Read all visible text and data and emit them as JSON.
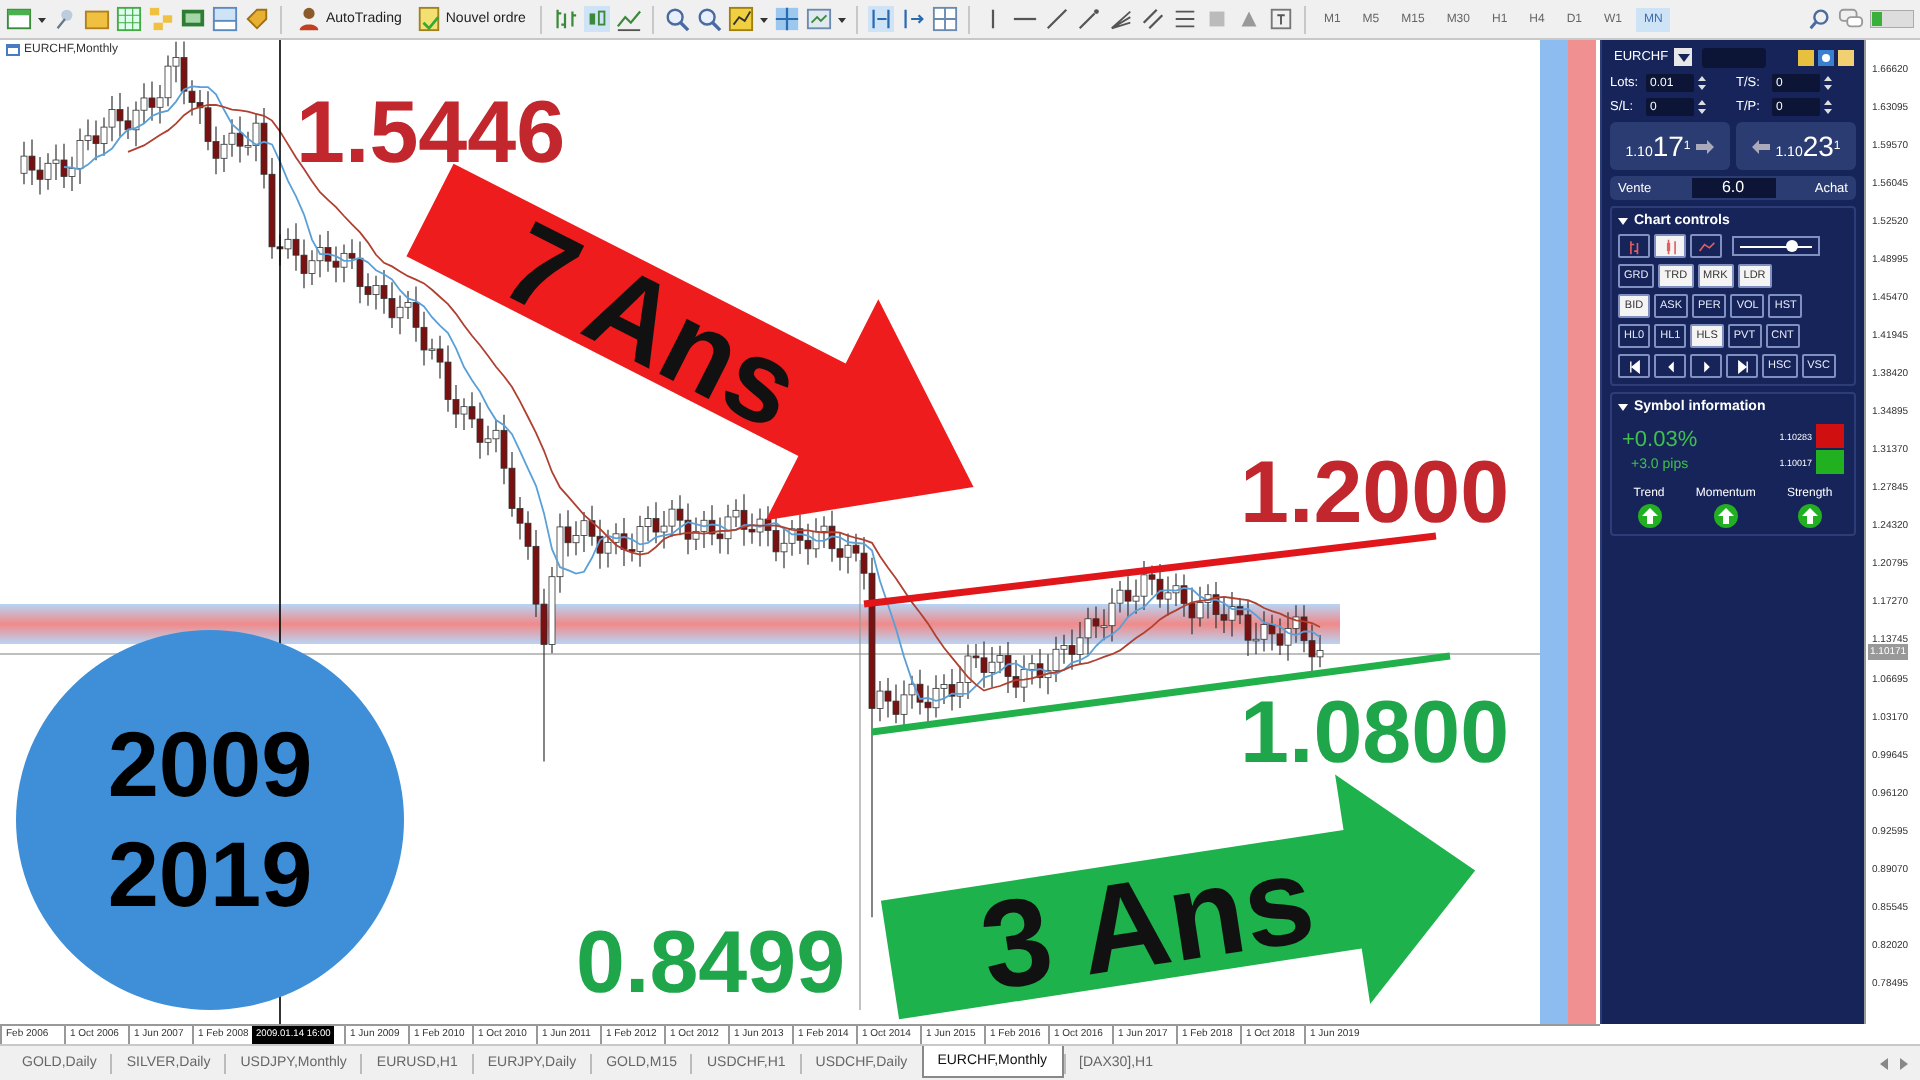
{
  "toolbar": {
    "buttons": [
      {
        "label": "AutoTrading"
      },
      {
        "label": "Nouvel ordre"
      }
    ],
    "timeframes": [
      {
        "label": "M1",
        "selected": false
      },
      {
        "label": "M5",
        "selected": false
      },
      {
        "label": "M15",
        "selected": false
      },
      {
        "label": "M30",
        "selected": false
      },
      {
        "label": "H1",
        "selected": false
      },
      {
        "label": "H4",
        "selected": false
      },
      {
        "label": "D1",
        "selected": false
      },
      {
        "label": "W1",
        "selected": false
      },
      {
        "label": "MN",
        "selected": true
      }
    ]
  },
  "chart": {
    "title": "EURCHF,Monthly",
    "price_axis": [
      "1.66620",
      "1.63095",
      "1.59570",
      "1.56045",
      "1.52520",
      "1.48995",
      "1.45470",
      "1.41945",
      "1.38420",
      "1.34895",
      "1.31370",
      "1.27845",
      "1.24320",
      "1.20795",
      "1.17270",
      "1.13745",
      "1.06695",
      "1.03170",
      "0.99645",
      "0.96120",
      "0.92595",
      "0.89070",
      "0.85545",
      "0.82020",
      "0.78495"
    ],
    "current_price": "1.10171",
    "time_axis": [
      "Feb 2006",
      "1 Oct 2006",
      "1 Jun 2007",
      "1 Feb 2008",
      "1 Jun 2009",
      "1 Feb 2010",
      "1 Oct 2010",
      "1 Jun 2011",
      "1 Feb 2012",
      "1 Oct 2012",
      "1 Jun 2013",
      "1 Feb 2014",
      "1 Oct 2014",
      "1 Jun 2015",
      "1 Feb 2016",
      "1 Oct 2016",
      "1 Jun 2017",
      "1 Feb 2018",
      "1 Oct 2018",
      "1 Jun 2019"
    ],
    "crosshair_time": "2009.01.14 16:00",
    "price_labels": [
      {
        "text": "1.5446",
        "color": "#c1272d"
      },
      {
        "text": "1.2000",
        "color": "#c1272d"
      },
      {
        "text": "1.0800",
        "color": "#1fa64a"
      },
      {
        "text": "0.8499",
        "color": "#1fa64a"
      }
    ],
    "arrows": [
      {
        "text": "7 Ans",
        "color": "#ee1c1c"
      },
      {
        "text": "3 Ans",
        "color": "#1db24b"
      }
    ],
    "trend_lines": [
      {
        "color": "#e0161b"
      },
      {
        "color": "#22b04b"
      }
    ],
    "period_circle": {
      "lines": [
        "2009",
        "2019"
      ]
    }
  },
  "trade_panel": {
    "symbol": "EURCHF",
    "fields": [
      {
        "label": "Lots:",
        "value": "0.01"
      },
      {
        "label": "T/S:",
        "value": "0"
      },
      {
        "label": "S/L:",
        "value": "0"
      },
      {
        "label": "T/P:",
        "value": "0"
      }
    ],
    "sell": {
      "prefix": "1.10",
      "digits": "17",
      "pip": "1",
      "label": "Vente"
    },
    "spread": "6.0",
    "buy": {
      "prefix": "1.10",
      "digits": "23",
      "pip": "1",
      "label": "Achat"
    }
  },
  "chart_controls": {
    "title": "Chart controls",
    "expanded": true,
    "chart_types": [
      {
        "selected": false
      },
      {
        "selected": true
      },
      {
        "selected": false
      }
    ],
    "zoom": {
      "level": 0.72
    },
    "rows": [
      [
        {
          "label": "GRD",
          "selected": false
        },
        {
          "label": "TRD",
          "selected": true
        },
        {
          "label": "MRK",
          "selected": true
        },
        {
          "label": "LDR",
          "selected": true
        }
      ],
      [
        {
          "label": "BID",
          "selected": true
        },
        {
          "label": "ASK",
          "selected": false
        },
        {
          "label": "PER",
          "selected": false
        },
        {
          "label": "VOL",
          "selected": false
        },
        {
          "label": "HST",
          "selected": false
        }
      ],
      [
        {
          "label": "HL0",
          "selected": false
        },
        {
          "label": "HL1",
          "selected": false
        },
        {
          "label": "HLS",
          "selected": true
        },
        {
          "label": "PVT",
          "selected": false
        },
        {
          "label": "CNT",
          "selected": false
        }
      ]
    ],
    "scroll_buttons": [
      {
        "label": "HSC",
        "selected": false
      },
      {
        "label": "VSC",
        "selected": false
      }
    ]
  },
  "symbol_info": {
    "title": "Symbol information",
    "expanded": true,
    "change": "+0.03%",
    "pips": "+3.0 pips",
    "high": "1.10283",
    "low": "1.10017",
    "indicators": [
      {
        "label": "Trend"
      },
      {
        "label": "Momentum"
      },
      {
        "label": "Strength"
      }
    ]
  },
  "tabs": [
    {
      "label": "GOLD,Daily",
      "selected": false
    },
    {
      "label": "SILVER,Daily",
      "selected": false
    },
    {
      "label": "USDJPY,Monthly",
      "selected": false
    },
    {
      "label": "EURUSD,H1",
      "selected": false
    },
    {
      "label": "EURJPY,Daily",
      "selected": false
    },
    {
      "label": "GOLD,M15",
      "selected": false
    },
    {
      "label": "USDCHF,H1",
      "selected": false
    },
    {
      "label": "USDCHF,Daily",
      "selected": false
    },
    {
      "label": "EURCHF,Monthly",
      "selected": true
    },
    {
      "label": "[DAX30],H1",
      "selected": false
    }
  ]
}
